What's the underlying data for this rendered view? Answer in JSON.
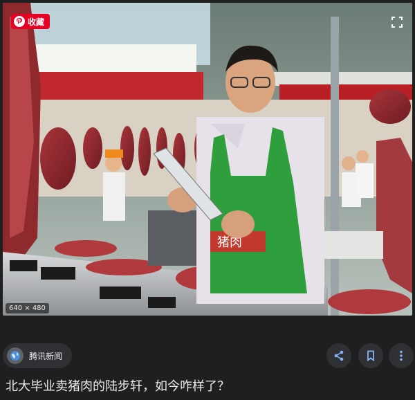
{
  "image": {
    "save_label": "收藏",
    "dimensions_label": "640 × 480",
    "stall_sign": "猪肉",
    "icons": [
      "pinterest-icon",
      "expand-icon"
    ]
  },
  "toolbar": {
    "source_name": "腾讯新闻",
    "source_icon": "globe-icon",
    "actions": [
      "share-icon",
      "bookmark-icon",
      "more-vert-icon"
    ]
  },
  "title": "北大毕业卖猪肉的陆步轩，如今咋样了？",
  "colors": {
    "background": "#1f1f1f",
    "chip": "#303134",
    "save_red": "#e60023",
    "apron_green": "#2f9e3c"
  }
}
